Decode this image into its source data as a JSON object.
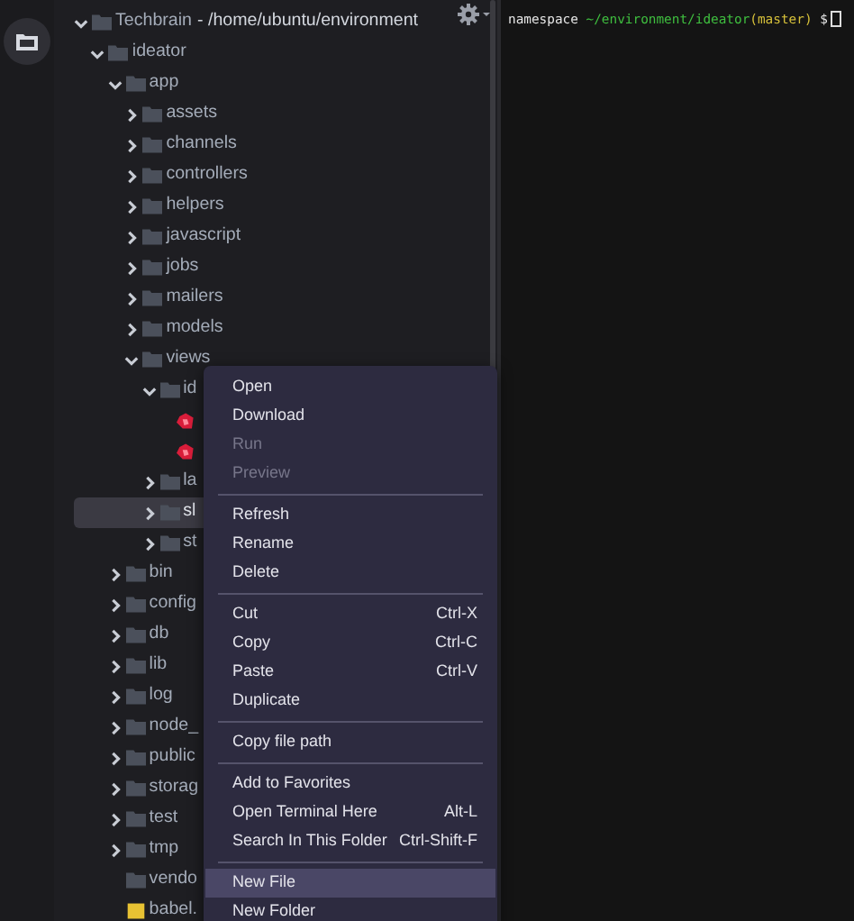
{
  "tree": {
    "name": "Techbrain",
    "path": "- /home/ubuntu/environment",
    "expanded": true,
    "children": [
      {
        "name": "ideator",
        "kind": "folder",
        "expanded": true,
        "selected": false,
        "children": [
          {
            "name": "app",
            "kind": "folder",
            "expanded": true,
            "selected": false,
            "children": [
              {
                "name": "assets",
                "kind": "folder",
                "expanded": false,
                "selected": false
              },
              {
                "name": "channels",
                "kind": "folder",
                "expanded": false,
                "selected": false
              },
              {
                "name": "controllers",
                "kind": "folder",
                "expanded": false,
                "selected": false
              },
              {
                "name": "helpers",
                "kind": "folder",
                "expanded": false,
                "selected": false
              },
              {
                "name": "javascript",
                "kind": "folder",
                "expanded": false,
                "selected": false
              },
              {
                "name": "jobs",
                "kind": "folder",
                "expanded": false,
                "selected": false
              },
              {
                "name": "mailers",
                "kind": "folder",
                "expanded": false,
                "selected": false
              },
              {
                "name": "models",
                "kind": "folder",
                "expanded": false,
                "selected": false
              },
              {
                "name": "views",
                "kind": "folder",
                "expanded": true,
                "selected": false,
                "children": [
                  {
                    "name": "id",
                    "kind": "folder",
                    "expanded": true,
                    "selected": false,
                    "children": [
                      {
                        "kind": "ruby-file",
                        "selected": false
                      },
                      {
                        "kind": "ruby-file",
                        "selected": false
                      }
                    ]
                  },
                  {
                    "name": "la",
                    "kind": "folder",
                    "expanded": false,
                    "selected": false
                  },
                  {
                    "name": "sl",
                    "kind": "folder",
                    "expanded": false,
                    "selected": true
                  },
                  {
                    "name": "st",
                    "kind": "folder",
                    "expanded": false,
                    "selected": false
                  }
                ]
              }
            ]
          },
          {
            "name": "bin",
            "kind": "folder",
            "expanded": false,
            "selected": false
          },
          {
            "name": "config",
            "kind": "folder",
            "expanded": false,
            "selected": false
          },
          {
            "name": "db",
            "kind": "folder",
            "expanded": false,
            "selected": false
          },
          {
            "name": "lib",
            "kind": "folder",
            "expanded": false,
            "selected": false
          },
          {
            "name": "log",
            "kind": "folder",
            "expanded": false,
            "selected": false
          },
          {
            "name": "node_",
            "kind": "folder",
            "expanded": false,
            "selected": false
          },
          {
            "name": "public",
            "kind": "folder",
            "expanded": false,
            "selected": false
          },
          {
            "name": "storag",
            "kind": "folder",
            "expanded": false,
            "selected": false
          },
          {
            "name": "test",
            "kind": "folder",
            "expanded": false,
            "selected": false
          },
          {
            "name": "tmp",
            "kind": "folder",
            "expanded": false,
            "selected": false
          },
          {
            "name": "vendo",
            "kind": "empty-folder",
            "selected": false
          },
          {
            "name": "babel.",
            "kind": "js-file",
            "selected": false
          }
        ]
      }
    ]
  },
  "context_menu": {
    "groups": [
      [
        {
          "label": "Open",
          "disabled": false,
          "selected": false
        },
        {
          "label": "Download",
          "disabled": false,
          "selected": false
        },
        {
          "label": "Run",
          "disabled": true,
          "selected": false
        },
        {
          "label": "Preview",
          "disabled": true,
          "selected": false
        }
      ],
      [
        {
          "label": "Refresh",
          "disabled": false,
          "selected": false
        },
        {
          "label": "Rename",
          "disabled": false,
          "selected": false
        },
        {
          "label": "Delete",
          "disabled": false,
          "selected": false
        }
      ],
      [
        {
          "label": "Cut",
          "shortcut": "Ctrl-X",
          "disabled": false,
          "selected": false
        },
        {
          "label": "Copy",
          "shortcut": "Ctrl-C",
          "disabled": false,
          "selected": false
        },
        {
          "label": "Paste",
          "shortcut": "Ctrl-V",
          "disabled": false,
          "selected": false
        },
        {
          "label": "Duplicate",
          "disabled": false,
          "selected": false
        }
      ],
      [
        {
          "label": "Copy file path",
          "disabled": false,
          "selected": false
        }
      ],
      [
        {
          "label": "Add to Favorites",
          "disabled": false,
          "selected": false
        },
        {
          "label": "Open Terminal Here",
          "shortcut": "Alt-L",
          "disabled": false,
          "selected": false
        },
        {
          "label": "Search In This Folder",
          "shortcut": "Ctrl-Shift-F",
          "disabled": false,
          "selected": false
        }
      ],
      [
        {
          "label": "New File",
          "disabled": false,
          "selected": true
        },
        {
          "label": "New Folder",
          "disabled": false,
          "selected": false
        }
      ]
    ]
  },
  "terminal": {
    "prompt": [
      {
        "kind": "user",
        "text": "namespace"
      },
      {
        "kind": "path",
        "text": "~/environment/ideator"
      },
      {
        "kind": "branch",
        "text": "(master)"
      },
      {
        "kind": "symbol",
        "text": "$"
      }
    ]
  }
}
